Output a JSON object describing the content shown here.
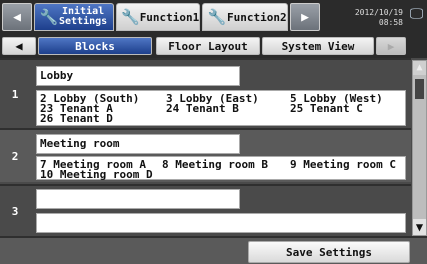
{
  "topbar": {
    "tabs": [
      {
        "label_line1": "Initial",
        "label_line2": "Settings",
        "icon": "wrench-icon",
        "active": true
      },
      {
        "label": "Function1",
        "icon": "wrench-icon"
      },
      {
        "label": "Function2",
        "icon": "wrench-icon"
      }
    ],
    "prev_icon": "◀",
    "next_icon": "▶",
    "date": "2012/10/19",
    "time": "08:58",
    "monitor_icon": "monitor-icon"
  },
  "subbar": {
    "prev_icon": "◀",
    "tabs": [
      "Blocks",
      "Floor Layout",
      "System View"
    ],
    "active": "Blocks",
    "next_icon": "▶"
  },
  "blocks": [
    {
      "number": "1",
      "name": "Lobby",
      "members": [
        [
          "2 Lobby (South)",
          "3 Lobby (East)",
          "5 Lobby (West)"
        ],
        [
          "23 Tenant A",
          "24 Tenant B",
          "25 Tenant C"
        ],
        [
          "26 Tenant D",
          "",
          ""
        ]
      ]
    },
    {
      "number": "2",
      "name": "Meeting room",
      "members": [
        [
          "7 Meeting room A",
          "8 Meeting room B",
          "9 Meeting room C"
        ],
        [
          "10 Meeting room D",
          "",
          ""
        ]
      ]
    },
    {
      "number": "3",
      "name": "",
      "members": []
    }
  ],
  "scrollbar": {
    "up_icon": "▲",
    "down_icon": "▼"
  },
  "bottom": {
    "save_label": "Save Settings"
  },
  "colors": {
    "accent": "#2a4f9b",
    "background": "#4a4a4a"
  }
}
